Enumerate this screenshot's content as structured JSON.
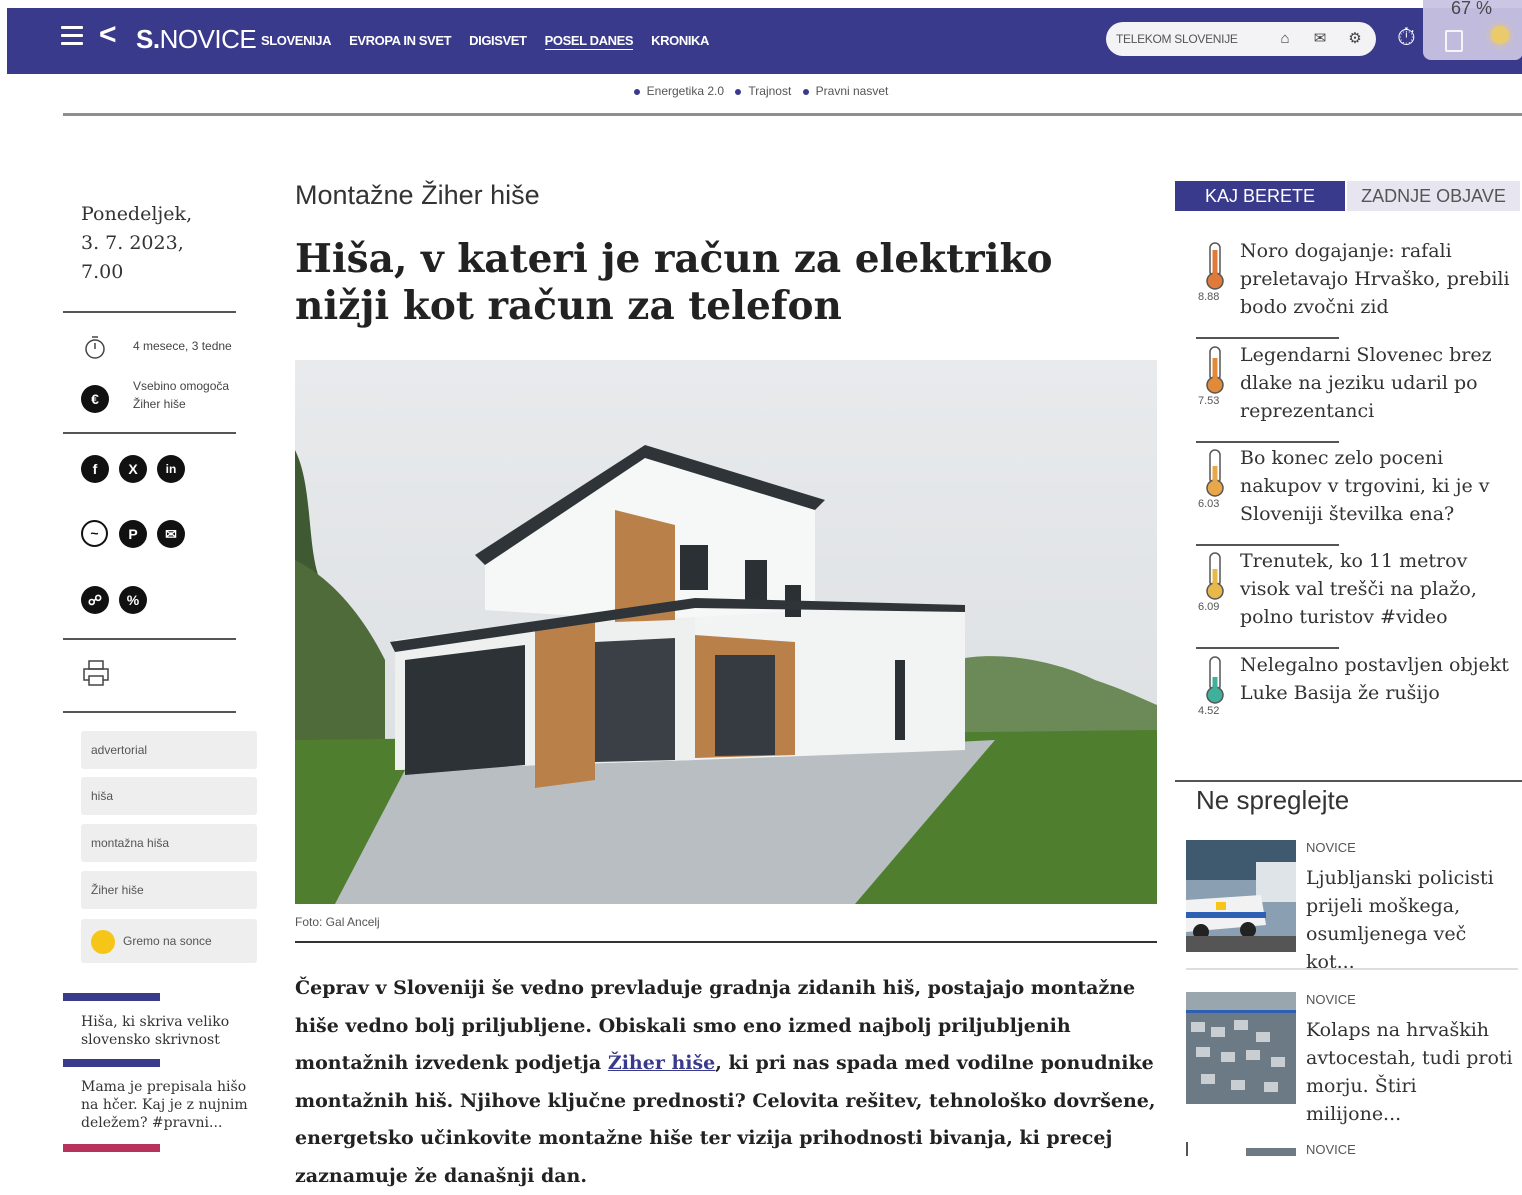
{
  "header": {
    "logo_bold": "S.",
    "logo_light": "NOVICE",
    "nav": [
      "SLOVENIJA",
      "EVROPA IN SVET",
      "DIGISVET",
      "POSEL DANES",
      "KRONIKA"
    ],
    "active_nav": "POSEL DANES",
    "pill_text": "TELEKOM SLOVENIJE",
    "battery_pct": "67 %"
  },
  "subnav": [
    "Energetika 2.0",
    "Trajnost",
    "Pravni nasvet"
  ],
  "left": {
    "date_line1": "Ponedeljek,",
    "date_line2": "3. 7. 2023,",
    "date_line3": "7.00",
    "read_age": "4 mesece, 3 tedne",
    "sponsor_line1": "Vsebino omogoča",
    "sponsor_line2": "Žiher hiše",
    "tags": [
      "advertorial",
      "hiša",
      "montažna hiša",
      "Žiher hiše",
      "Gremo na sonce"
    ],
    "related": [
      {
        "title": "Hiša, ki skriva veliko slovensko skrivnost",
        "color": "#3a3a8c"
      },
      {
        "title": "Mama je prepisala hišo na hčer. Kaj je z nujnim deležem? #pravni...",
        "color": "#3a3a8c"
      },
      {
        "title": "",
        "color": "#b8325e"
      }
    ]
  },
  "article": {
    "kicker": "Montažne Žiher hiše",
    "headline": "Hiša, v kateri je račun za elektriko nižji kot račun za telefon",
    "photo_credit": "Foto: Gal Ancelj",
    "body_before_link": "Čeprav v Sloveniji še vedno prevladuje gradnja zidanih hiš, postajajo montažne hiše vedno bolj priljubljene. Obiskali smo eno izmed najbolj priljubljenih montažnih izvedenk podjetja ",
    "body_link": "Žiher hiše",
    "body_after_link": ", ki pri nas spada med vodilne ponudnike montažnih hiš. Njihove ključne prednosti? Celovita rešitev, tehnološko dovršene, energetsko učinkovite montažne hiše ter vizija prihodnosti bivanja, ki precej zaznamuje že današnji dan."
  },
  "right": {
    "tab_active": "KAJ BERETE",
    "tab_inactive": "ZADNJE OBJAVE",
    "trending": [
      {
        "title": "Noro dogajanje: rafali preletavajo Hrvaško, prebili bodo zvočni zid",
        "score": "8.88",
        "level": 0.9,
        "color": "#e07a3a"
      },
      {
        "title": "Legendarni Slovenec brez dlake na jeziku udaril po reprezentanci",
        "score": "7.53",
        "level": 0.75,
        "color": "#e08a3a"
      },
      {
        "title": "Bo konec zelo poceni nakupov v trgovini, ki je v Sloveniji številka ena?",
        "score": "6.03",
        "level": 0.6,
        "color": "#e8a84a"
      },
      {
        "title": "Trenutek, ko 11 metrov visok val trešči na plažo, polno turistov #video",
        "score": "6.09",
        "level": 0.6,
        "color": "#e8b84a"
      },
      {
        "title": "Nelegalno postavljen objekt Luke Basija že rušijo",
        "score": "4.52",
        "level": 0.45,
        "color": "#3fb09a"
      }
    ],
    "dont_miss_title": "Ne spreglejte",
    "dont_miss": [
      {
        "category": "NOVICE",
        "title": "Ljubljanski policisti prijeli moškega, osumljenega več kot..."
      },
      {
        "category": "NOVICE",
        "title": "Kolaps na hrvaških avtocestah, tudi proti morju. Štiri milijone..."
      },
      {
        "category": "NOVICE",
        "title": ""
      }
    ]
  }
}
